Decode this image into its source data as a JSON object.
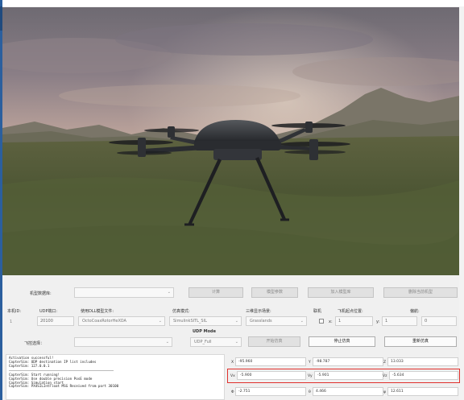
{
  "colors": {
    "highlight": "#e0302c",
    "sidebar_accent": "#2b5f9e"
  },
  "top": {
    "model_db_label": "机型数据库:",
    "btn_compute": "计算",
    "btn_model_params": "模型参数",
    "btn_add_model": "加入模型库",
    "btn_delete_model": "删除当前机型"
  },
  "form": {
    "headers": {
      "id": "本机ID:",
      "udp_port": "UDP端口:",
      "dll_file": "使用DLL模型文件:",
      "sim_mode": "仿真模式:",
      "scene": "三维显示场景:",
      "networked": "联机",
      "takeoff_pos": "飞机起点位置:",
      "yaw": "偏航:"
    },
    "values": {
      "id": "1",
      "udp_port": "20100",
      "dll_file": "OctoCoaxRotorHeXOA",
      "sim_mode": "SimulinkSITL_SIL",
      "scene": "Grasslands",
      "x_label": "x:",
      "x_value": "1",
      "y_label": "y:",
      "y_value": "1",
      "yaw_value": "0"
    },
    "udp_mode_label": "UDP Mode",
    "udp_mode_value": "UDP_Full",
    "fc_select_label": "飞控选择：",
    "btn_start": "开始仿真",
    "btn_stop": "停止仿真",
    "btn_restart": "重新仿真"
  },
  "log": {
    "lines_a": [
      "Activation successful!",
      "CopterSim: UDP destination IP list includes",
      "CopterSim: 127.0.0.1"
    ],
    "lines_b": [
      "CopterSim: Start running!",
      "CopterSim: Use double precision PosE mode",
      "CopterSim: Simulation start",
      "CopterSim: PX4SILIntFloat MSG Received from port 30100"
    ]
  },
  "telemetry": {
    "row1": [
      {
        "label": "X",
        "value": "-95.960"
      },
      {
        "label": "Y",
        "value": "-98.787"
      },
      {
        "label": "Z",
        "value": "13.033"
      }
    ],
    "row2": [
      {
        "label": "Vx",
        "value": "-5.900"
      },
      {
        "label": "Vy",
        "value": "-5.901"
      },
      {
        "label": "Vz",
        "value": "-5.634"
      }
    ],
    "row3": [
      {
        "label": "Φ",
        "value": "-2.751"
      },
      {
        "label": "θ",
        "value": "4.466"
      },
      {
        "label": "ψ",
        "value": "12.611"
      }
    ]
  }
}
